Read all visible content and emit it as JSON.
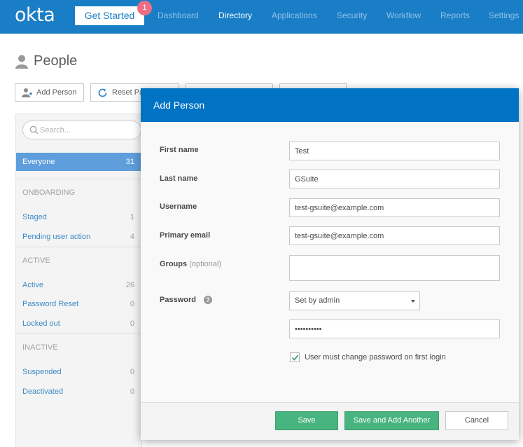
{
  "app": {
    "logo": "okta",
    "get_started_label": "Get Started",
    "get_started_badge": "1"
  },
  "nav": {
    "items": [
      {
        "label": "Dashboard"
      },
      {
        "label": "Directory",
        "active": true
      },
      {
        "label": "Applications"
      },
      {
        "label": "Security"
      },
      {
        "label": "Workflow"
      },
      {
        "label": "Reports"
      },
      {
        "label": "Settings"
      }
    ]
  },
  "page": {
    "title": "People",
    "toolbar": {
      "add_person": "Add Person",
      "reset_passwords": "Reset Pa"
    }
  },
  "sidebar": {
    "search_placeholder": "Search...",
    "everyone": {
      "label": "Everyone",
      "count": "31"
    },
    "onboarding_header": "ONBOARDING",
    "staged": {
      "label": "Staged",
      "count": "1"
    },
    "pending": {
      "label": "Pending user action",
      "count": "4"
    },
    "active_header": "ACTIVE",
    "active": {
      "label": "Active",
      "count": "26"
    },
    "password_reset": {
      "label": "Password Reset",
      "count": "0"
    },
    "locked_out": {
      "label": "Locked out",
      "count": "0"
    },
    "inactive_header": "INACTIVE",
    "suspended": {
      "label": "Suspended",
      "count": "0"
    },
    "deactivated": {
      "label": "Deactivated",
      "count": "0"
    }
  },
  "modal": {
    "title": "Add Person",
    "first_name_label": "First name",
    "first_name_value": "Test",
    "last_name_label": "Last name",
    "last_name_value": "GSuite",
    "username_label": "Username",
    "username_value": "test-gsuite@example.com",
    "primary_email_label": "Primary email",
    "primary_email_value": "test-gsuite@example.com",
    "groups_label": "Groups",
    "groups_optional": "(optional)",
    "groups_value": "",
    "password_label": "Password",
    "password_help": "?",
    "password_mode": "Set by admin",
    "password_value": "••••••••••",
    "must_change_label": "User must change password on first login",
    "must_change_checked": true,
    "save_label": "Save",
    "save_add_another_label": "Save and Add Another",
    "cancel_label": "Cancel"
  },
  "colors": {
    "nav_bg": "#1a7ec6",
    "modal_header_bg": "#0073c4",
    "primary_button": "#48b47f",
    "badge": "#ee6e84",
    "sidebar_selected": "#5e9edc",
    "link": "#3c8ac6"
  }
}
